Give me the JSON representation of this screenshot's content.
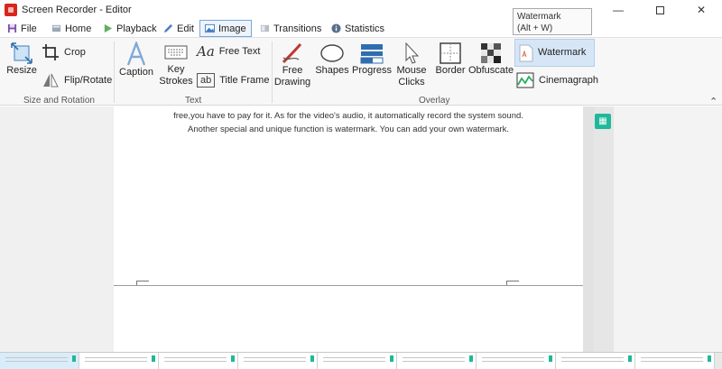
{
  "window": {
    "title": "Screen Recorder - Editor"
  },
  "tabs": [
    {
      "label": "File",
      "icon": "save-icon"
    },
    {
      "label": "Home",
      "icon": "home-icon"
    },
    {
      "label": "Playback",
      "icon": "play-icon"
    },
    {
      "label": "Edit",
      "icon": "pencil-icon"
    },
    {
      "label": "Image",
      "icon": "image-icon",
      "active": true
    },
    {
      "label": "Transitions",
      "icon": "transitions-icon"
    },
    {
      "label": "Statistics",
      "icon": "info-icon"
    }
  ],
  "ribbon": {
    "size_rotation": {
      "label": "Size and Rotation",
      "resize": "Resize",
      "crop": "Crop",
      "flip_rotate": "Flip/Rotate"
    },
    "text": {
      "label": "Text",
      "caption": "Caption",
      "key_strokes_1": "Key",
      "key_strokes_2": "Strokes",
      "free_text": "Free Text",
      "title_frame": "Title Frame"
    },
    "overlay": {
      "label": "Overlay",
      "free_drawing_1": "Free",
      "free_drawing_2": "Drawing",
      "shapes": "Shapes",
      "progress": "Progress",
      "mouse_clicks_1": "Mouse",
      "mouse_clicks_2": "Clicks",
      "border": "Border",
      "obfuscate": "Obfuscate",
      "watermark": "Watermark",
      "cinemagraph": "Cinemagraph"
    }
  },
  "tooltip": {
    "line1": "Watermark",
    "line2": "(Alt + W)"
  },
  "document": {
    "line1": "free,you have to pay for it. As for the video's audio, it automatically record the system sound.",
    "line2": "Another special and unique function is watermark. You can add your own watermark."
  },
  "colors": {
    "accent": "#1fb89a",
    "tab_active_border": "#7aa7d8",
    "highlight": "#d6e6f7"
  }
}
